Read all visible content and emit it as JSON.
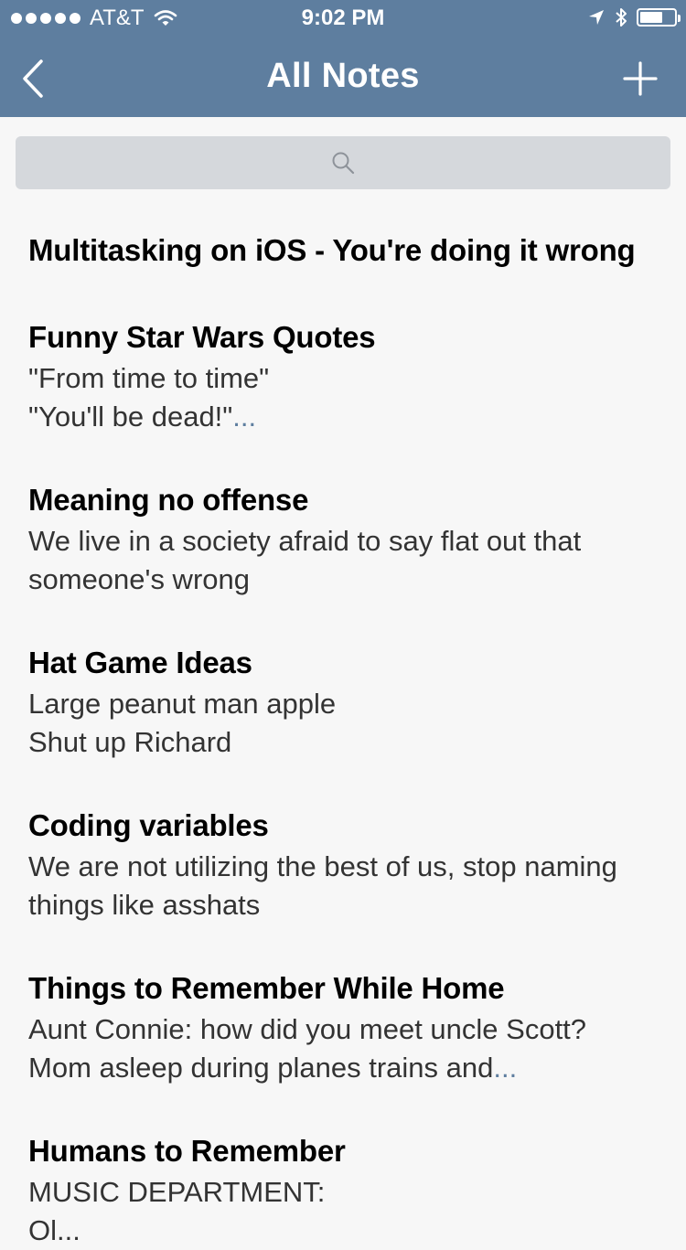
{
  "status_bar": {
    "carrier": "AT&T",
    "time": "9:02 PM"
  },
  "nav": {
    "title": "All Notes",
    "back_icon": "chevron-left-icon",
    "add_icon": "plus-icon"
  },
  "search": {
    "icon": "search-icon",
    "placeholder": ""
  },
  "notes": [
    {
      "title": "Multitasking on iOS - You're doing it wrong",
      "lines": []
    },
    {
      "title": "Funny Star Wars Quotes",
      "lines": [
        "\"From time to time\"",
        "\"You'll be dead!\""
      ],
      "truncated": true
    },
    {
      "title": "Meaning no offense",
      "lines": [
        "We live in a society afraid to say flat out that",
        "someone's wrong"
      ]
    },
    {
      "title": "Hat Game Ideas",
      "lines": [
        "Large peanut man apple",
        "Shut up Richard"
      ]
    },
    {
      "title": "Coding variables",
      "lines": [
        "We are not utilizing the best of us, stop naming",
        "things like asshats"
      ]
    },
    {
      "title": "Things to Remember While Home",
      "lines": [
        "Aunt Connie: how did you meet uncle Scott?",
        "Mom asleep during planes trains and"
      ],
      "truncated": true
    },
    {
      "title": "Humans to Remember",
      "lines": [
        "MUSIC DEPARTMENT:",
        "Ol..."
      ]
    }
  ],
  "ellipsis": "...",
  "colors": {
    "nav_bar": "#5e7e9f",
    "background": "#f7f7f7",
    "search_field": "#d5d8dc",
    "accent": "#5e7e9f"
  }
}
